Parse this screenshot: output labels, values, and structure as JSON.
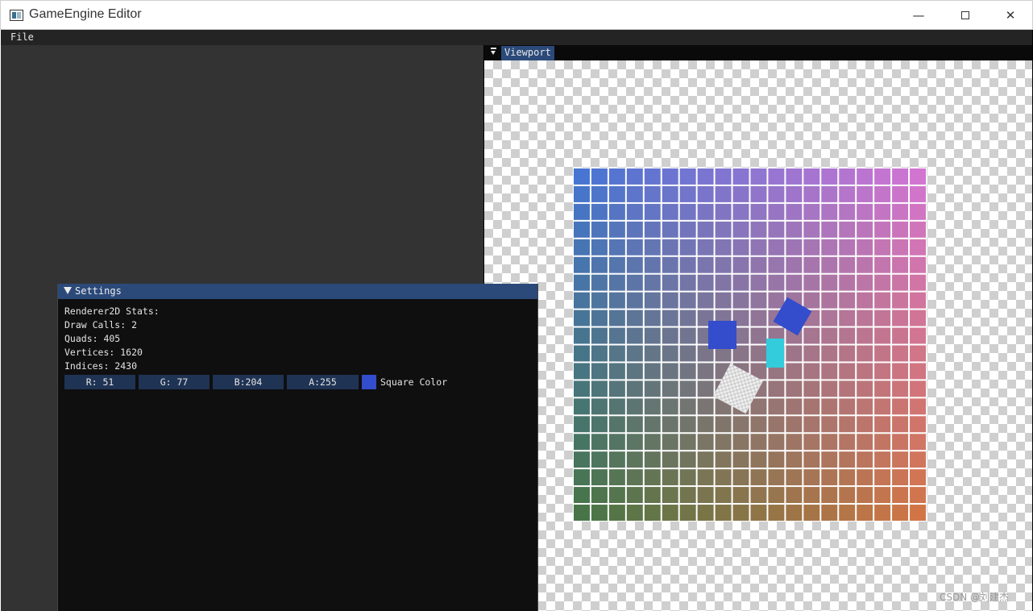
{
  "window": {
    "title": "GameEngine Editor",
    "minimize_glyph": "—",
    "close_glyph": "✕"
  },
  "menu": {
    "file_label": "File"
  },
  "viewport": {
    "tab_label": "Viewport"
  },
  "settings": {
    "title": "Settings",
    "stats_heading": "Renderer2D Stats:",
    "draw_calls": "Draw Calls: 2",
    "quads": "Quads: 405",
    "vertices": "Vertices: 1620",
    "indices": "Indices: 2430",
    "color_fields": {
      "r": "R: 51",
      "g": "G: 77",
      "b": "B:204",
      "a": "A:255"
    },
    "square_color_label": "Square Color",
    "square_color_hex": "#334dcc"
  },
  "scene": {
    "blue_square_color": "#334dcc",
    "cyan_quad_color": "#33ccdd",
    "grid_colors": {
      "top_left": "#3366cc",
      "top_right": "#cc66cc",
      "bottom_left": "#336633",
      "bottom_right": "#cc6633"
    }
  },
  "watermark": "CSDN @刘建杰"
}
